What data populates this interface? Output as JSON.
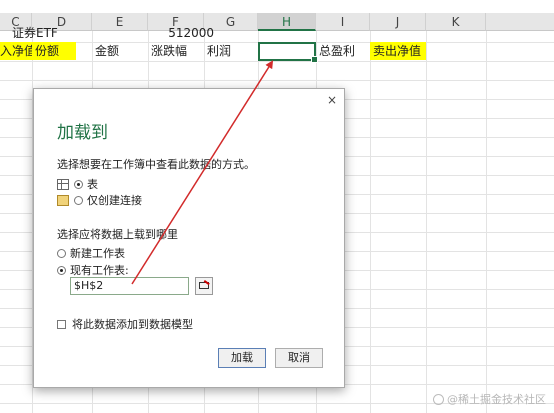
{
  "columns": [
    "C",
    "D",
    "E",
    "F",
    "G",
    "H",
    "I",
    "J",
    "K"
  ],
  "selected_column": "H",
  "cells": {
    "row1": {
      "c": "证券ETF",
      "f": "512000"
    },
    "row2": {
      "c": "入净值",
      "d": "份额",
      "e": "金额",
      "f": "涨跌幅",
      "g": "利润",
      "h": "",
      "i": "总盈利",
      "j": "卖出净值"
    }
  },
  "colors": {
    "highlight": "#ffff00",
    "accent": "#217346",
    "arrow": "#d22b2b"
  },
  "dialog": {
    "close_label": "×",
    "title": "加载到",
    "prompt_view": "选择想要在工作簿中查看此数据的方式。",
    "options_view": [
      {
        "label": "表",
        "selected": true,
        "icon": "table-icon"
      },
      {
        "label": "仅创建连接",
        "selected": false,
        "icon": "connection-icon"
      }
    ],
    "prompt_location": "选择应将数据上载到哪里",
    "options_location": [
      {
        "label": "新建工作表",
        "selected": false
      },
      {
        "label": "现有工作表:",
        "selected": true
      }
    ],
    "reference_value": "$H$2",
    "add_to_model_label": "将此数据添加到数据模型",
    "load_button": "加载",
    "cancel_button": "取消"
  },
  "watermark": "@稀土掘金技术社区"
}
